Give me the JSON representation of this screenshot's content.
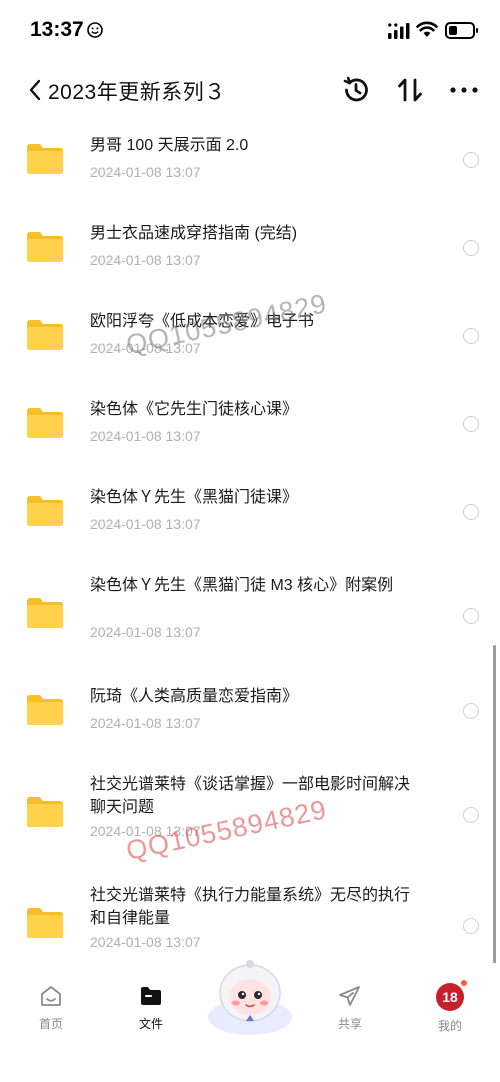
{
  "status_bar": {
    "time": "13:37"
  },
  "header": {
    "title": "2023年更新系列３"
  },
  "files": [
    {
      "name": "男哥 100 天展示面 2.0",
      "date": "2024-01-08 13:07"
    },
    {
      "name": "男士衣品速成穿搭指南 (完结)",
      "date": "2024-01-08 13:07"
    },
    {
      "name": "欧阳浮夸《低成本恋爱》电子书",
      "date": "2024-01-08 13:07"
    },
    {
      "name": "染色体《它先生门徒核心课》",
      "date": "2024-01-08 13:07"
    },
    {
      "name": "染色体Ｙ先生《黑猫门徒课》",
      "date": "2024-01-08 13:07"
    },
    {
      "name": "染色体Ｙ先生《黑猫门徒 M3 核心》附案例",
      "date": "2024-01-08 13:07"
    },
    {
      "name": "阮琦《人类高质量恋爱指南》",
      "date": "2024-01-08 13:07"
    },
    {
      "name": "社交光谱莱特《谈话掌握》一部电影时间解决聊天问题",
      "date": "2024-01-08 13:07"
    },
    {
      "name": "社交光谱莱特《执行力能量系统》无尽的执行和自律能量",
      "date": "2024-01-08 13:07"
    }
  ],
  "watermark": "QQ1055894829",
  "nav": {
    "home": "首页",
    "files": "文件",
    "share": "共享",
    "mine": "我的",
    "avatar_text": "18"
  },
  "colors": {
    "folder": "#ffd24a",
    "folder_tab": "#f5be2a",
    "watermark": "#d74646",
    "date": "#b0b0b8"
  }
}
